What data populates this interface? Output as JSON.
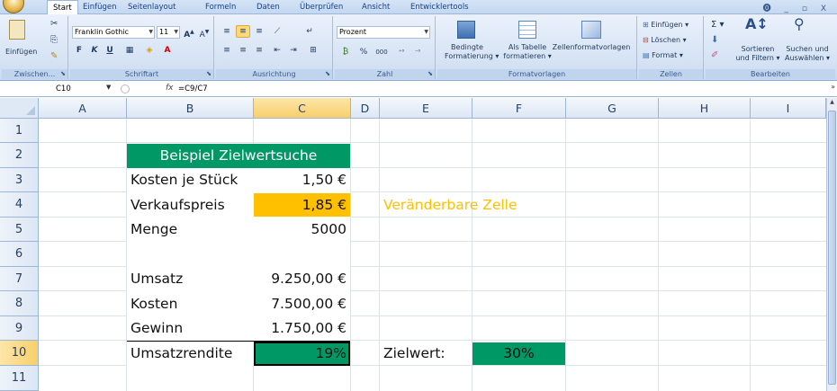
{
  "ribbon": {
    "tabs": [
      "Start",
      "Einfügen",
      "Seitenlayout",
      "Formeln",
      "Daten",
      "Überprüfen",
      "Ansicht",
      "Entwicklertools"
    ],
    "active_tab": "Start",
    "window_controls": "⓿ _ ▫ X",
    "groups": {
      "clipboard": {
        "paste_label": "Einfügen",
        "group_label": "Zwischen..."
      },
      "font": {
        "font_name": "Franklin Gothic",
        "font_size": "11",
        "group_label": "Schriftart",
        "bold": "F",
        "italic": "K",
        "underline": "U"
      },
      "alignment": {
        "group_label": "Ausrichtung"
      },
      "number": {
        "format": "Prozent",
        "group_label": "Zahl",
        "percent": "%",
        "thousands": "000"
      },
      "styles": {
        "conditional_line1": "Bedingte",
        "conditional_line2": "Formatierung ▾",
        "table_line1": "Als Tabelle",
        "table_line2": "formatieren ▾",
        "cellstyles": "Zellenformatvorlagen",
        "group_label": "Formatvorlagen"
      },
      "cells": {
        "insert": "Einfügen ▾",
        "delete": "Löschen ▾",
        "format": "Format ▾",
        "group_label": "Zellen"
      },
      "editing": {
        "sum": "Σ ▾",
        "sort_line1": "Sortieren",
        "sort_line2": "und Filtern ▾",
        "find_line1": "Suchen und",
        "find_line2": "Auswählen ▾",
        "group_label": "Bearbeiten"
      }
    }
  },
  "formula_bar": {
    "name_box": "C10",
    "fx": "fx",
    "formula": "=C9/C7"
  },
  "grid": {
    "columns": [
      "A",
      "B",
      "C",
      "D",
      "E",
      "F",
      "G",
      "H",
      "I"
    ],
    "rows": [
      "1",
      "2",
      "3",
      "4",
      "5",
      "6",
      "7",
      "8",
      "9",
      "10",
      "11"
    ],
    "selected_column": "C",
    "selected_row": "10"
  },
  "cells": {
    "B2": "Beispiel Zielwertsuche",
    "B3": "Kosten je Stück",
    "C3": "1,50 €",
    "B4": "Verkaufspreis",
    "C4": "1,85 €",
    "E4": "Veränderbare Zelle",
    "B5": "Menge",
    "C5": "5000",
    "B7": "Umsatz",
    "C7": "9.250,00 €",
    "B8": "Kosten",
    "C8": "7.500,00 €",
    "B9": "Gewinn",
    "C9": "1.750,00 €",
    "B10": "Umsatzrendite",
    "C10": "19%",
    "E10": "Zielwert:",
    "F10": "30%"
  },
  "colors": {
    "header_green": "#009966",
    "highlight_orange": "#ffc000",
    "orange_text": "#ffc000",
    "selection": "#f8cf6b"
  }
}
